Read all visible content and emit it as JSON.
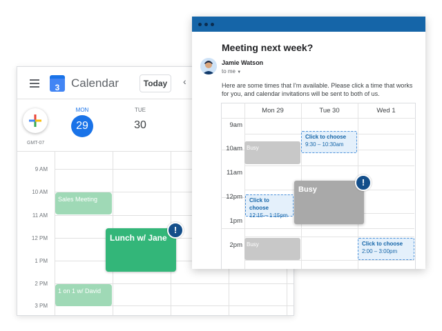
{
  "calendar": {
    "app_title": "Calendar",
    "logo_number": "3",
    "today_label": "Today",
    "timezone": "GMT-07",
    "days": [
      {
        "label": "MON",
        "number": "29"
      },
      {
        "label": "TUE",
        "number": "30"
      }
    ],
    "times": [
      "9 AM",
      "10 AM",
      "11 AM",
      "12 PM",
      "1 PM",
      "2 PM",
      "3 PM"
    ],
    "events": [
      {
        "title": "Sales Meeting"
      },
      {
        "title": "Lunch w/ Jane"
      },
      {
        "title": "1 on 1 w/ David"
      }
    ],
    "alert_symbol": "!"
  },
  "email": {
    "subject": "Meeting next week?",
    "sender": "Jamie Watson",
    "recipient": "to me",
    "body": "Here are some times that I'm available. Please click a time that works for you, and calendar invitations will be sent to both of us.",
    "grid": {
      "days": [
        "Mon 29",
        "Tue 30",
        "Wed 1"
      ],
      "times": [
        "9am",
        "10am",
        "11am",
        "12pm",
        "1pm",
        "2pm"
      ],
      "busy_label": "Busy",
      "choose_label": "Click to choose",
      "slots": [
        {
          "time": "9:30 – 10:30am"
        },
        {
          "time": "12:15 – 1:15pm"
        },
        {
          "time": "2:00 – 3:00pm"
        }
      ]
    },
    "alert_symbol": "!"
  },
  "colors": {
    "accent_blue": "#1a73e8",
    "event_green": "#33b679",
    "event_green_light": "#9fd9b6",
    "title_bar": "#1565a8",
    "busy_gray": "#a9a9a9"
  }
}
